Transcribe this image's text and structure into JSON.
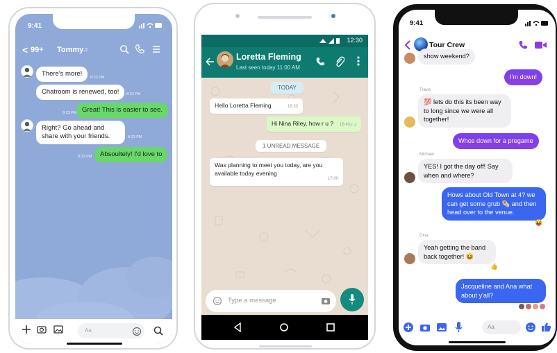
{
  "line_app": {
    "status_time": "9:41",
    "back_label": "<",
    "unread_count": "99+",
    "contact_name": "Tommy",
    "messages": [
      {
        "text": "There's more!",
        "time": "8:23 PM",
        "side": "in"
      },
      {
        "text": "Chatroom is renewed, too!",
        "time": "8:23 PM",
        "side": "in"
      },
      {
        "text": "Great! This is easier to see.",
        "time": "8:23 PM",
        "side": "out"
      },
      {
        "text": "Right? Go ahead and share with your friends.",
        "time": "8:23 PM",
        "side": "in"
      },
      {
        "text": "Absoultely! I'd love to",
        "time": "8:23 PM",
        "side": "out"
      }
    ],
    "input_placeholder": "Aa",
    "icons": [
      "search-icon",
      "phone-icon",
      "menu-icon",
      "plus-icon",
      "camera-icon",
      "image-icon",
      "emoji-icon",
      "search-icon"
    ],
    "background": "#8fa9d8",
    "accent_green": "#68d86a"
  },
  "whatsapp_app": {
    "status_time": "12:30",
    "contact_name": "Loretta Fleming",
    "last_seen": "Last seen today 11:00 AM",
    "date_pill": "TODAY",
    "messages": [
      {
        "text": "Hello Loretta Fleming",
        "time": "16:33",
        "side": "in"
      },
      {
        "text": "Hi Nina Riley, how r u ?",
        "time": "16:40",
        "side": "out"
      }
    ],
    "unread_pill": "1 UNREAD MESSAGE",
    "unread_message": {
      "text": "Was planning to meet you today, are you available today evening",
      "time": "17:00"
    },
    "input_placeholder": "Type a message",
    "icons": [
      "back-arrow-icon",
      "phone-icon",
      "attach-icon",
      "more-icon",
      "emoji-icon",
      "camera-icon",
      "mic-icon",
      "nav-back-icon",
      "nav-home-icon",
      "nav-recents-icon"
    ],
    "header_color": "#0e7b71",
    "out_bubble_color": "#dcf8c6"
  },
  "messenger_app": {
    "status_time": "9:41",
    "group_name": "Tour Crew",
    "messages": [
      {
        "sender": "",
        "text": "show weekend?",
        "side": "in"
      },
      {
        "sender": "",
        "text": "I'm down!",
        "side": "out"
      },
      {
        "sender": "Travis",
        "text": "💯 lets do this its been way to long since we were all together!",
        "side": "in"
      },
      {
        "sender": "",
        "text": "Whos down for a pregame",
        "side": "out"
      },
      {
        "sender": "Michael",
        "text": "YES! I got the day off! Say when and where?",
        "side": "in"
      },
      {
        "sender": "",
        "text": "Hows about Old Town at 4? we can get some grub 🌯 and then head over to the venue.",
        "side": "out"
      },
      {
        "sender": "Gina",
        "text": "Yeah getting the band back together! 😆",
        "side": "in"
      },
      {
        "sender": "",
        "text": "Jacqueline and Ana what about y'all?",
        "side": "out"
      }
    ],
    "reactions": {
      "venue": "😝",
      "band": "👍"
    },
    "input_placeholder": "Aa",
    "icons": [
      "back-icon",
      "phone-icon",
      "video-icon",
      "plus-icon",
      "camera-icon",
      "image-icon",
      "mic-icon",
      "emoji-icon",
      "thumbs-up-icon"
    ],
    "accent_purple": "#8a3ce6",
    "accent_blue": "#3a66f0"
  }
}
